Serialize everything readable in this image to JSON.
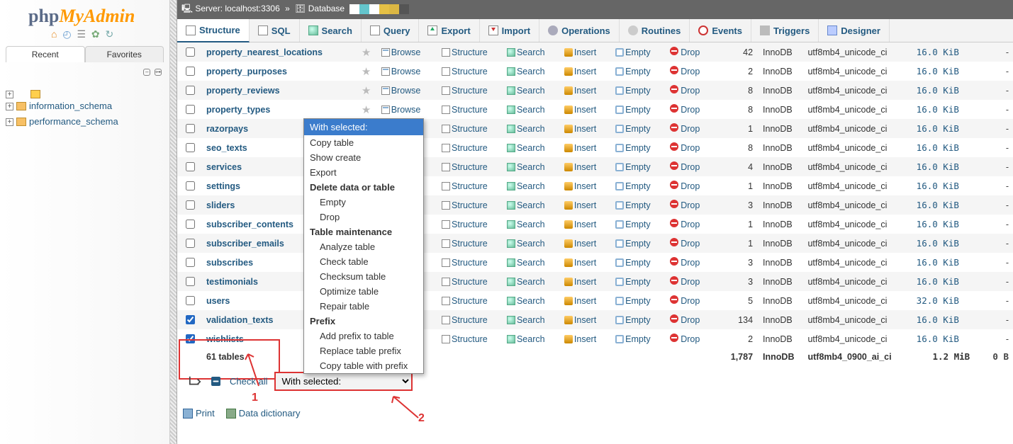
{
  "logo_a": "php",
  "logo_b": "MyAdmin",
  "nav_tabs": {
    "recent": "Recent",
    "favorites": "Favorites"
  },
  "db_tree": {
    "information_schema": "information_schema",
    "performance_schema": "performance_schema"
  },
  "breadcrumb": {
    "server_label": "Server:",
    "server": "localhost:3306",
    "db_label": "Database",
    "sep": "»"
  },
  "color_strip": [
    "#ffffff",
    "#64c5cc",
    "#ffffff",
    "#e5c045",
    "#dcb743",
    "#555555"
  ],
  "tabs": {
    "structure": "Structure",
    "sql": "SQL",
    "search": "Search",
    "query": "Query",
    "export": "Export",
    "import": "Import",
    "operations": "Operations",
    "routines": "Routines",
    "events": "Events",
    "triggers": "Triggers",
    "designer": "Designer"
  },
  "actions": {
    "browse": "Browse",
    "structure": "Structure",
    "search": "Search",
    "insert": "Insert",
    "empty": "Empty",
    "drop": "Drop"
  },
  "rows": [
    {
      "name": "property_nearest_locations",
      "rows": 42,
      "engine": "InnoDB",
      "collation": "utf8mb4_unicode_ci",
      "size": "16.0 KiB",
      "overhead": "-",
      "chk": false,
      "odd": true,
      "hlrow": false
    },
    {
      "name": "property_purposes",
      "rows": 2,
      "engine": "InnoDB",
      "collation": "utf8mb4_unicode_ci",
      "size": "16.0 KiB",
      "overhead": "-",
      "chk": false,
      "odd": false,
      "hlrow": false
    },
    {
      "name": "property_reviews",
      "rows": 8,
      "engine": "InnoDB",
      "collation": "utf8mb4_unicode_ci",
      "size": "16.0 KiB",
      "overhead": "-",
      "chk": false,
      "odd": true,
      "hlrow": false
    },
    {
      "name": "property_types",
      "rows": 8,
      "engine": "InnoDB",
      "collation": "utf8mb4_unicode_ci",
      "size": "16.0 KiB",
      "overhead": "-",
      "chk": false,
      "odd": false,
      "hlrow": false
    },
    {
      "name": "razorpays",
      "rows": 1,
      "engine": "InnoDB",
      "collation": "utf8mb4_unicode_ci",
      "size": "16.0 KiB",
      "overhead": "-",
      "chk": false,
      "odd": true,
      "hlrow": false
    },
    {
      "name": "seo_texts",
      "rows": 8,
      "engine": "InnoDB",
      "collation": "utf8mb4_unicode_ci",
      "size": "16.0 KiB",
      "overhead": "-",
      "chk": false,
      "odd": false,
      "hlrow": false
    },
    {
      "name": "services",
      "rows": 4,
      "engine": "InnoDB",
      "collation": "utf8mb4_unicode_ci",
      "size": "16.0 KiB",
      "overhead": "-",
      "chk": false,
      "odd": true,
      "hlrow": false
    },
    {
      "name": "settings",
      "rows": 1,
      "engine": "InnoDB",
      "collation": "utf8mb4_unicode_ci",
      "size": "16.0 KiB",
      "overhead": "-",
      "chk": false,
      "odd": false,
      "hlrow": false
    },
    {
      "name": "sliders",
      "rows": 3,
      "engine": "InnoDB",
      "collation": "utf8mb4_unicode_ci",
      "size": "16.0 KiB",
      "overhead": "-",
      "chk": false,
      "odd": true,
      "hlrow": false
    },
    {
      "name": "subscriber_contents",
      "rows": 1,
      "engine": "InnoDB",
      "collation": "utf8mb4_unicode_ci",
      "size": "16.0 KiB",
      "overhead": "-",
      "chk": false,
      "odd": false,
      "hlrow": false
    },
    {
      "name": "subscriber_emails",
      "rows": 1,
      "engine": "InnoDB",
      "collation": "utf8mb4_unicode_ci",
      "size": "16.0 KiB",
      "overhead": "-",
      "chk": false,
      "odd": true,
      "hlrow": false
    },
    {
      "name": "subscribes",
      "rows": 3,
      "engine": "InnoDB",
      "collation": "utf8mb4_unicode_ci",
      "size": "16.0 KiB",
      "overhead": "-",
      "chk": false,
      "odd": false,
      "hlrow": false
    },
    {
      "name": "testimonials",
      "rows": 3,
      "engine": "InnoDB",
      "collation": "utf8mb4_unicode_ci",
      "size": "16.0 KiB",
      "overhead": "-",
      "chk": false,
      "odd": true,
      "hlrow": false
    },
    {
      "name": "users",
      "rows": 5,
      "engine": "InnoDB",
      "collation": "utf8mb4_unicode_ci",
      "size": "32.0 KiB",
      "overhead": "-",
      "chk": false,
      "odd": false,
      "hlrow": false
    },
    {
      "name": "validation_texts",
      "rows": 134,
      "engine": "InnoDB",
      "collation": "utf8mb4_unicode_ci",
      "size": "16.0 KiB",
      "overhead": "-",
      "chk": true,
      "odd": true,
      "hlrow": true
    },
    {
      "name": "wishlists",
      "rows": 2,
      "engine": "InnoDB",
      "collation": "utf8mb4_unicode_ci",
      "size": "16.0 KiB",
      "overhead": "-",
      "chk": true,
      "odd": false,
      "hlrow": true
    }
  ],
  "sum": {
    "label": "61 tables",
    "rows": "1,787",
    "engine": "InnoDB",
    "collation": "utf8mb4_0900_ai_ci",
    "size": "1.2 MiB",
    "overhead": "0 B"
  },
  "ctx": {
    "title": "With selected:",
    "copy_table": "Copy table",
    "show_create": "Show create",
    "export": "Export",
    "delete_header": "Delete data or table",
    "empty": "Empty",
    "drop": "Drop",
    "maint_header": "Table maintenance",
    "analyze": "Analyze table",
    "check": "Check table",
    "checksum": "Checksum table",
    "optimize": "Optimize table",
    "repair": "Repair table",
    "prefix_header": "Prefix",
    "add_prefix": "Add prefix to table",
    "replace_prefix": "Replace table prefix",
    "copy_prefix": "Copy table with prefix"
  },
  "checkall": {
    "label": "Check all",
    "with_selected": "With selected:"
  },
  "footer": {
    "print": "Print",
    "dict": "Data dictionary"
  },
  "anno": {
    "one": "1",
    "two": "2"
  }
}
